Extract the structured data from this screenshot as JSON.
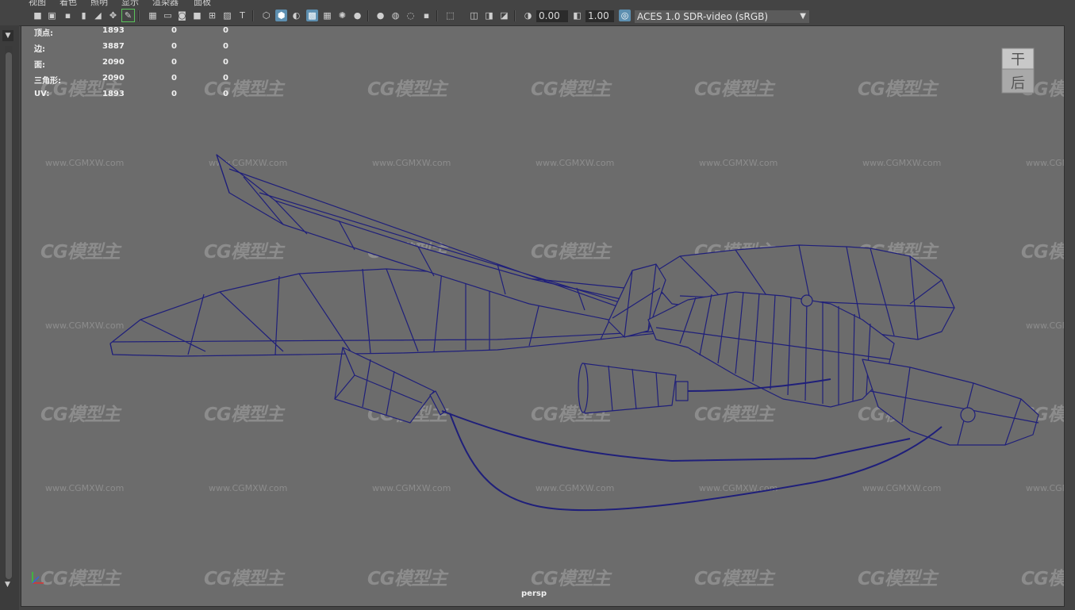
{
  "menu": {
    "items": [
      "视图",
      "着色",
      "照明",
      "显示",
      "渲染器",
      "面板"
    ]
  },
  "toolbar": {
    "exposure_value": "0.00",
    "gamma_value": "1.00",
    "color_space": "ACES 1.0 SDR-video (sRGB)",
    "icons": [
      "camera-icon",
      "camera-attributes-icon",
      "bookmark-icon",
      "image-plane-icon",
      "grease-pencil-icon",
      "grid-icon",
      "film-gate-icon",
      "resolution-gate-icon",
      "gate-mask-icon",
      "field-chart-icon",
      "safe-action-icon",
      "safe-title-icon",
      "wireframe-icon",
      "smooth-shade-icon",
      "default-material-icon",
      "wireframe-on-shaded-icon",
      "textured-icon",
      "lights-icon",
      "shadows-icon",
      "screen-space-ao-icon",
      "motion-blur-icon",
      "multisample-aa-icon",
      "depth-of-field-icon",
      "isolate-select-icon",
      "xray-icon",
      "xray-joints-icon",
      "xray-components-icon",
      "exposure-icon",
      "gamma-icon",
      "color-management-icon"
    ]
  },
  "hud": {
    "rows": [
      {
        "label": "顶点:",
        "v1": "1893",
        "v2": "0",
        "v3": "0"
      },
      {
        "label": "边:",
        "v1": "3887",
        "v2": "0",
        "v3": "0"
      },
      {
        "label": "面:",
        "v1": "2090",
        "v2": "0",
        "v3": "0"
      },
      {
        "label": "三角形:",
        "v1": "2090",
        "v2": "0",
        "v3": "0"
      },
      {
        "label": "UV:",
        "v1": "1893",
        "v2": "0",
        "v3": "0"
      }
    ]
  },
  "viewcube": {
    "top": "干",
    "face": "后"
  },
  "watermark": {
    "brand": "CG模型主",
    "url": "www.CGMXW.com"
  },
  "camera": {
    "name": "persp"
  },
  "colors": {
    "wire": "#1a1a6e",
    "viewport_bg": "#6c6c6c",
    "panel_bg": "#444444"
  }
}
